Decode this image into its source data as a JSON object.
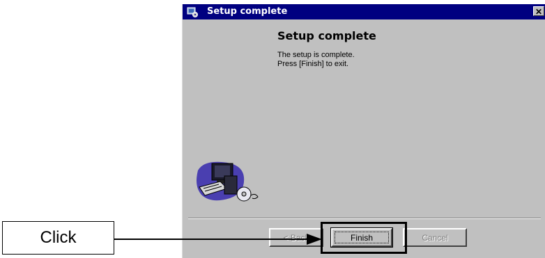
{
  "window": {
    "title": "Setup complete",
    "close_glyph": "✕"
  },
  "content": {
    "heading": "Setup complete",
    "line1": "The setup is complete.",
    "line2": "Press [Finish] to exit."
  },
  "buttons": {
    "back_label": "< Back",
    "finish_label": "Finish",
    "cancel_label": "Cancel"
  },
  "annotation": {
    "callout_label": "Click"
  },
  "icons": {
    "title_icon": "setup-icon",
    "illustration": "computer-cd-icon"
  },
  "colors": {
    "titlebar": "#000080",
    "dialog_bg": "#c0c0c0"
  }
}
